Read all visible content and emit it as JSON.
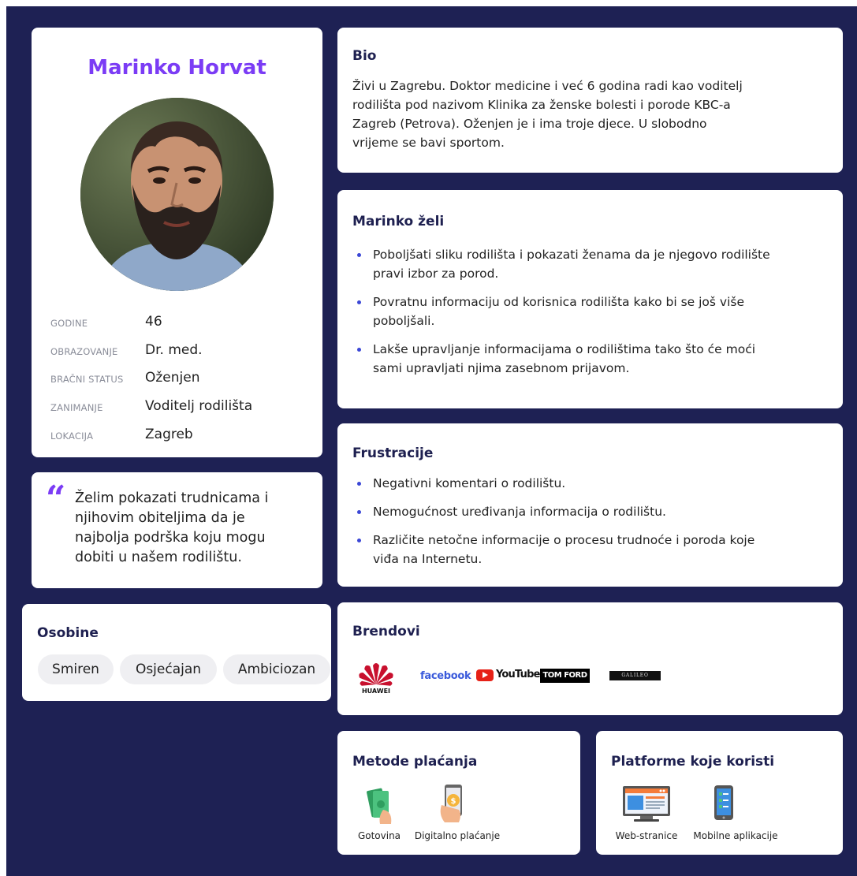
{
  "profile": {
    "name": "Marinko Horvat",
    "fields": [
      {
        "label": "GODINE",
        "value": "46"
      },
      {
        "label": "OBRAZOVANJE",
        "value": "Dr. med."
      },
      {
        "label": "BRAČNI STATUS",
        "value": "Oženjen"
      },
      {
        "label": "ZANIMANJE",
        "value": "Voditelj rodilišta"
      },
      {
        "label": "LOKACIJA",
        "value": "Zagreb"
      }
    ]
  },
  "quote": {
    "lines": [
      "Želim pokazati trudnicama i",
      "njihovim obiteljima da je",
      "najbolja podrška koju mogu",
      "dobiti u našem rodilištu."
    ]
  },
  "traits": {
    "title": "Osobine",
    "items": [
      "Smiren",
      "Osjećajan",
      "Ambiciozan"
    ]
  },
  "bio": {
    "title": "Bio",
    "lines": [
      "Živi u Zagrebu. Doktor medicine i već 6 godina radi kao voditelj",
      "rodilišta pod nazivom Klinika za ženske bolesti i porode KBC-a",
      "Zagreb (Petrova). Oženjen je i ima troje djece. U slobodno",
      "vrijeme se bavi sportom."
    ]
  },
  "wants": {
    "title": "Marinko želi",
    "items": [
      [
        "Poboljšati sliku rodilišta i pokazati ženama da je njegovo rodilište",
        "pravi izbor za porod."
      ],
      [
        "Povratnu informaciju od korisnica rodilišta kako bi se još više",
        "poboljšali."
      ],
      [
        "Lakše upravljanje informacijama o rodilištima tako što će moći",
        "sami upravljati njima zasebnom prijavom."
      ]
    ]
  },
  "frustrations": {
    "title": "Frustracije",
    "items": [
      [
        "Negativni komentari o rodilištu."
      ],
      [
        "Nemogućnost uređivanja informacija o rodilištu."
      ],
      [
        "Različite netočne informacije o procesu trudnoće i poroda koje",
        "viđa na Internetu."
      ]
    ]
  },
  "brands": {
    "title": "Brendovi",
    "huawei": "HUAWEI",
    "facebook": "facebook",
    "youtube": "YouTube",
    "tomford": "TOM FORD",
    "galileo": "GALILEO"
  },
  "payment": {
    "title": "Metode plaćanja",
    "items": [
      "Gotovina",
      "Digitalno plaćanje"
    ]
  },
  "platforms": {
    "title": "Platforme koje koristi",
    "items": [
      "Web-stranice",
      "Mobilne aplikacije"
    ]
  },
  "colors": {
    "background": "#1e2154",
    "accent": "#7b3cf5",
    "bullet": "#3b47d6",
    "chip": "#efeff2"
  }
}
